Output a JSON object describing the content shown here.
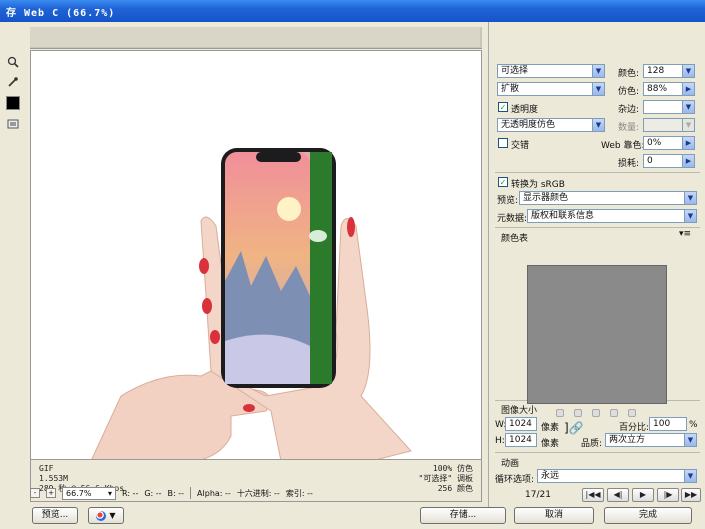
{
  "window": {
    "title": "存 Web C (66.7%)"
  },
  "left_tools": [
    "zoom-icon",
    "eyedropper-icon",
    "color-swatch",
    "toggle-slices-icon"
  ],
  "info": {
    "format": "GIF",
    "size": "1.553M",
    "time": "289 秒 @ 56.6 Kbps",
    "dither": "100% 仿色",
    "palette": "\"可选择\" 调板",
    "colors": "256 颜色"
  },
  "status": {
    "zoom": "66.7%",
    "r": "R: --",
    "g": "G: --",
    "b": "B: --",
    "alpha": "Alpha: --",
    "hex": "十六进制: --",
    "index": "索引: --"
  },
  "buttons": {
    "preview": "预览...",
    "save": "存储...",
    "cancel": "取消",
    "done": "完成"
  },
  "settings": {
    "reduction": "可选择",
    "dither_algo": "扩散",
    "transparency_label": "透明度",
    "matte_dither": "无透明度仿色",
    "interlaced_label": "交错",
    "colors_label": "颜色:",
    "colors_value": "128",
    "dither_label": "仿色:",
    "dither_value": "88%",
    "matte_label": "杂边:",
    "amount_label": "数量:",
    "websnap_label": "Web 靠色:",
    "websnap_value": "0%",
    "lossy_label": "损耗:",
    "lossy_value": "0",
    "srgb_label": "转换为 sRGB",
    "preview_label": "预览:",
    "preview_value": "显示器颜色",
    "metadata_label": "元数据:",
    "metadata_value": "版权和联系信息"
  },
  "color_table": {
    "title": "颜色表",
    "swatch_color": "#8a8a8a"
  },
  "image_size": {
    "title": "图像大小",
    "w_label": "W:",
    "w_value": "1024",
    "h_label": "H:",
    "h_value": "1024",
    "unit": "像素",
    "percent_label": "百分比:",
    "percent_value": "100",
    "percent_unit": "%",
    "quality_label": "品质:",
    "quality_value": "两次立方"
  },
  "animation": {
    "title": "动画",
    "loop_label": "循环选项:",
    "loop_value": "永远",
    "frame": "17/21"
  }
}
